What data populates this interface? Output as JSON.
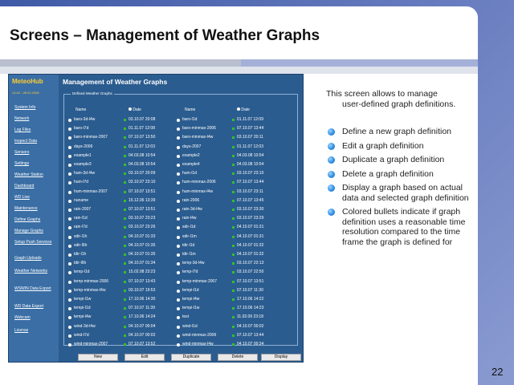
{
  "slide": {
    "title": "Screens – Management of Weather Graphs",
    "page_number": "22",
    "intro_line1": "This screen allows to manage",
    "intro_line2": "user-defined graph definitions.",
    "bullets": [
      "Define a new graph definition",
      "Edit a graph definition",
      "Duplicate a graph definition",
      "Delete a graph definition",
      "Display a graph based on actual data and selected graph definition",
      "Colored bullets indicate if graph definition uses a reasonable time resolution compared to the time frame the graph is defined for"
    ]
  },
  "app": {
    "logo": "MeteoHub",
    "date": "12:42 - 28.02.2008",
    "page_title": "Management of Weather Graphs",
    "nav": [
      "System Info",
      "Network",
      "Log Files",
      "Inspect Data",
      "Sensors",
      "Settings",
      "Weather Station",
      "Dashboard",
      "WD Live",
      "Maintenance",
      "Define Graphs",
      "Manage Graphs",
      "Setup Push Services",
      "Graph Uploads",
      "Weather Networks",
      "WSWIN Data Export",
      "WD Data Export",
      "Webcam",
      "License"
    ],
    "fieldset_legend": "Defined Weather Graphs",
    "col_headers": [
      "Name",
      "Date",
      "Name",
      "Date"
    ],
    "rows": [
      [
        "baro-3d-l4w",
        "03.10.07 20:08",
        "baro-l1d",
        "01.11.07 12:09"
      ],
      [
        "baro-l7d",
        "01.11.07 12:08",
        "baro-minmax-2006",
        "07.10.07 13:44"
      ],
      [
        "baro-minmax-2007",
        "07.10.07 13:50",
        "baro-minmax-l4w",
        "03.10.07 20:11"
      ],
      [
        "days-2006",
        "01.11.07 12:03",
        "days-2007",
        "01.11.07 12:03"
      ],
      [
        "example1",
        "04.03.08 10:54",
        "example2",
        "04.03.08 10:54"
      ],
      [
        "example3",
        "04.03.08 10:54",
        "example4",
        "04.03.08 10:54"
      ],
      [
        "hum-3d-l4w",
        "03.10.07 20:09",
        "hum-l1d",
        "03.10.07 23:10"
      ],
      [
        "hum-l7d",
        "03.10.07 23:10",
        "hum-minmax-2006",
        "07.10.07 13:44"
      ],
      [
        "hum-minmax-2007",
        "07.10.07 13:51",
        "hum-minmax-l4w",
        "03.10.07 23:11"
      ],
      [
        "nuname",
        "15.12.06 13:39",
        "rain-2006",
        "07.10.07 13:45"
      ],
      [
        "rain-2007",
        "07.10.07 13:51",
        "rain-3d-l4w",
        "03.10.07 23:30"
      ],
      [
        "rain-l1d",
        "03.10.07 23:23",
        "rain-l4w",
        "03.10.07 23:29"
      ],
      [
        "rain-l7d",
        "03.10.07 23:26",
        "sdir-l1d",
        "04.10.07 01:31"
      ],
      [
        "sdir-l1h",
        "04.10.07 01:33",
        "sdir-l1m",
        "04.10.07 01:31"
      ],
      [
        "sdir-l6h",
        "04.10.07 01:35",
        "tdir-l1d",
        "04.10.07 01:32"
      ],
      [
        "tdir-l1h",
        "04.10.07 01:35",
        "tdir-l1m",
        "04.10.07 01:32"
      ],
      [
        "tdir-l6h",
        "04.10.07 01:34",
        "temp-3d-l4w",
        "03.10.07 22:13"
      ],
      [
        "temp-l1d",
        "15.02.08 23:23",
        "temp-l7d",
        "03.10.07 22:50"
      ],
      [
        "temp-minmax-2006",
        "07.10.07 13:43",
        "temp-minmax-2007",
        "07.10.07 13:51"
      ],
      [
        "temp-minmax-l4w",
        "03.10.07 19:53",
        "tempi-l1d",
        "07.10.07 11:30"
      ],
      [
        "tempi-l1w",
        "17.10.06 14:30",
        "tempi-l4w",
        "17.10.06 14:22"
      ],
      [
        "tempi-l1d",
        "07.10.07 11:39",
        "tempi-l1w",
        "17.10.06 14:23"
      ],
      [
        "tempi-l4w",
        "17.10.06 14:24",
        "test",
        "11.02.09 23:18"
      ],
      [
        "wind-3d-l4w",
        "04.10.07 00:04",
        "wind-l1d",
        "04.10.07 00:02"
      ],
      [
        "wind-l7d",
        "04.10.07 00:02",
        "wind-minmax-2006",
        "07.10.07 13:44"
      ],
      [
        "wind-minmax-2007",
        "07.10.07 13:52",
        "wind-minmax-l4w",
        "04.10.07 00:34"
      ]
    ],
    "buttons": [
      "New",
      "Edit",
      "Duplicate",
      "Delete",
      "Display"
    ],
    "colors": {
      "bullet_ok": "#2ec12e",
      "app_bg": "#2b5c8f",
      "logo": "#ffcc33"
    }
  }
}
